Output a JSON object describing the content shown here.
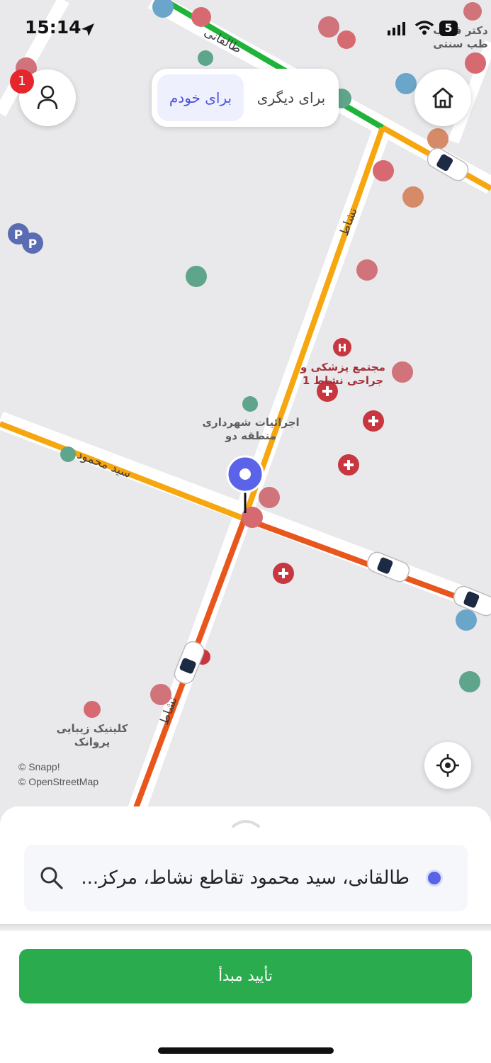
{
  "status_bar": {
    "time": "15:14",
    "battery": "5"
  },
  "top": {
    "profile_badge_count": "1",
    "segment_active": "برای خودم",
    "segment_other": "برای دیگری"
  },
  "map": {
    "streets": {
      "top_road": "طالقانی",
      "left_road": "سید محمود",
      "vertical_road_upper": "نشاط",
      "vertical_road_lower": "نشاط"
    },
    "places": {
      "medical_complex_line1": "مجتمع پزشکی و",
      "medical_complex_line2": "جراحی نشاط 1",
      "municipality_line1": "اجرائیات شهرداری",
      "municipality_line2": "منطقه دو",
      "clinic_line1": "کلینیک زیبایی",
      "clinic_line2": "پروانک",
      "corner_line1": "دکتر قطب",
      "corner_line2": "طب سنتی"
    },
    "attribution_1": "© Snapp!",
    "attribution_2": "© OpenStreetMap",
    "colors": {
      "traffic_green": "#1fb33a",
      "traffic_yellow": "#f6a710",
      "traffic_orange": "#e8561b",
      "pin": "#5b63e8"
    }
  },
  "sheet": {
    "address": "طالقانی، سید محمود تقاطع نشاط، مرکز...",
    "confirm_button": "تأیید مبدأ"
  },
  "icons": {
    "profile": "person-icon",
    "home": "home-icon",
    "locate": "crosshair-icon",
    "search": "search-icon"
  }
}
